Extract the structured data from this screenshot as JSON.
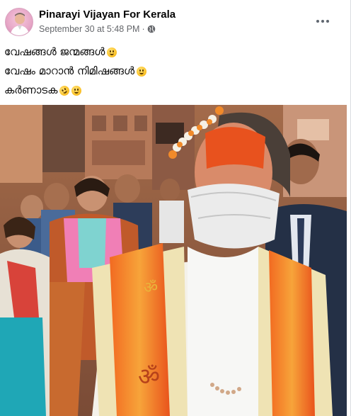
{
  "post": {
    "author": "Pinarayi Vijayan For Kerala",
    "timestamp": "September 30 at 5:48 PM",
    "separator": "·",
    "privacy_icon": "globe-icon",
    "more_icon": "more-options-icon",
    "lines": [
      {
        "text": "വേഷങ്ങൾ ജന്മങ്ങൾ",
        "emoji": "grinning-face-icon"
      },
      {
        "text": "വേഷം മാറാൻ നിമിഷങ്ങൾ",
        "emoji": "grinning-face-icon"
      },
      {
        "text": "കർണാടക",
        "emojis": [
          "rolling-on-floor-laughing-icon",
          "grinning-face-icon"
        ]
      }
    ],
    "photo_alt": "photo"
  },
  "colors": {
    "accent_orange": "#f26a21",
    "scarf_cream": "#efe3b4",
    "text_primary": "#050505",
    "text_secondary": "#65676b"
  }
}
